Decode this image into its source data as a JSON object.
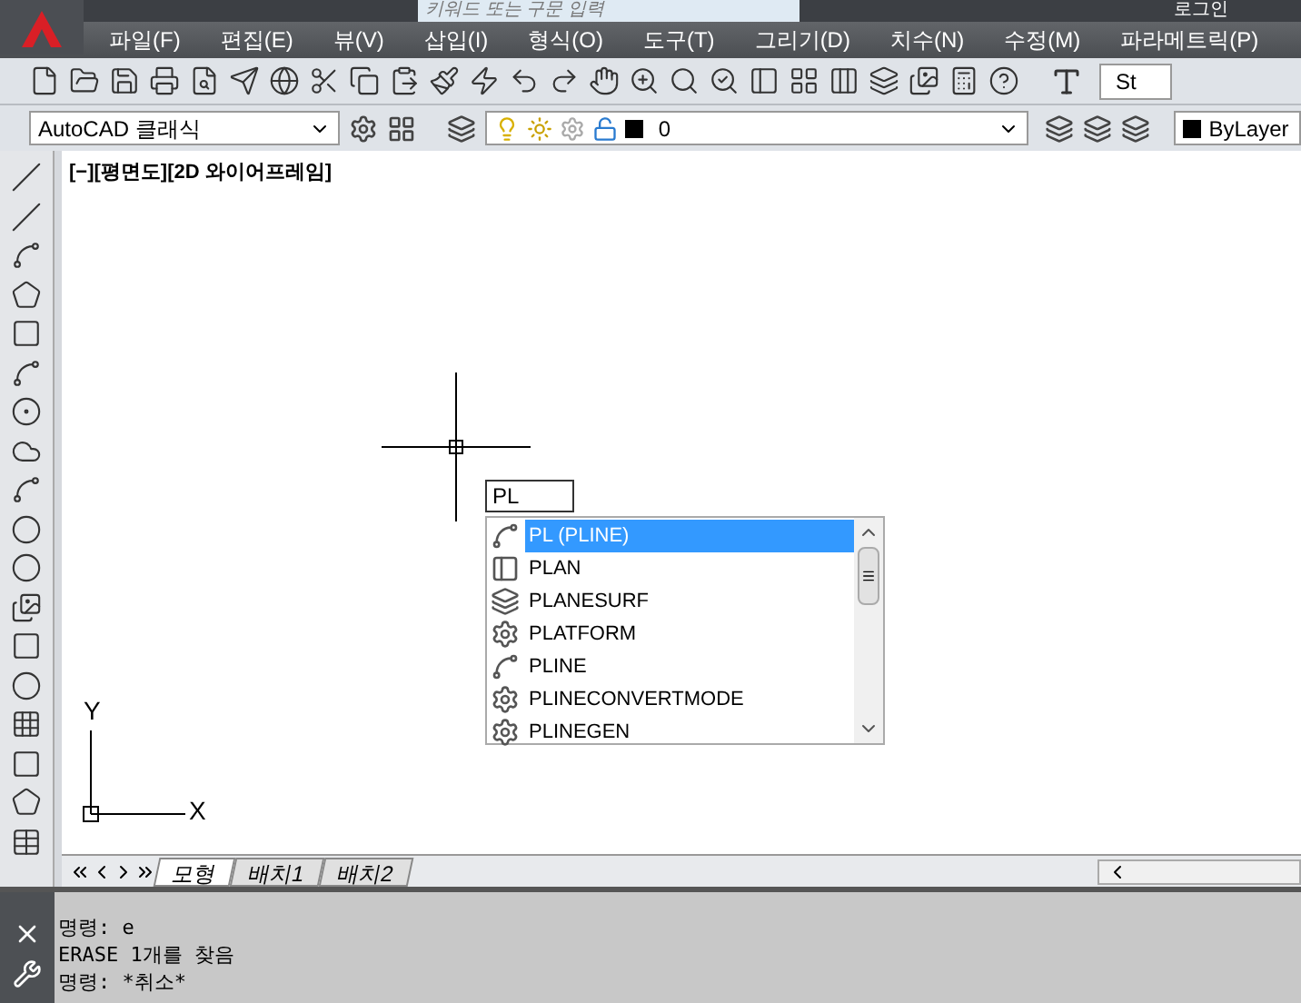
{
  "title_bar": {
    "search_placeholder": "키워드 또는 구문 입력",
    "sign_in": "로그인"
  },
  "menu": [
    "파일(F)",
    "편집(E)",
    "뷰(V)",
    "삽입(I)",
    "형식(O)",
    "도구(T)",
    "그리기(D)",
    "치수(N)",
    "수정(M)",
    "파라메트릭(P)"
  ],
  "text_style": {
    "value": "St"
  },
  "workspace": {
    "value": "AutoCAD 클래식"
  },
  "layer": {
    "name": "0"
  },
  "color_control": {
    "value": "ByLayer"
  },
  "viewport_label": "[−][평면도][2D 와이어프레임]",
  "command_input": {
    "value": "PL"
  },
  "suggestions": [
    {
      "label": "PL (PLINE)",
      "kind": "polyline",
      "selected": true
    },
    {
      "label": "PLAN",
      "kind": "plan",
      "selected": false
    },
    {
      "label": "PLANESURF",
      "kind": "surface",
      "selected": false
    },
    {
      "label": "PLATFORM",
      "kind": "setting",
      "selected": false
    },
    {
      "label": "PLINE",
      "kind": "polyline",
      "selected": false
    },
    {
      "label": "PLINECONVERTMODE",
      "kind": "setting",
      "selected": false
    },
    {
      "label": "PLINEGEN",
      "kind": "setting",
      "selected": false
    }
  ],
  "ucs": {
    "x_label": "X",
    "y_label": "Y"
  },
  "layout_tabs": [
    {
      "label": "모형",
      "selected": true
    },
    {
      "label": "배치1",
      "selected": false
    },
    {
      "label": "배치2",
      "selected": false
    }
  ],
  "command_history": [
    "명령: e",
    "ERASE 1개를 찾음",
    "명령: *취소*"
  ]
}
